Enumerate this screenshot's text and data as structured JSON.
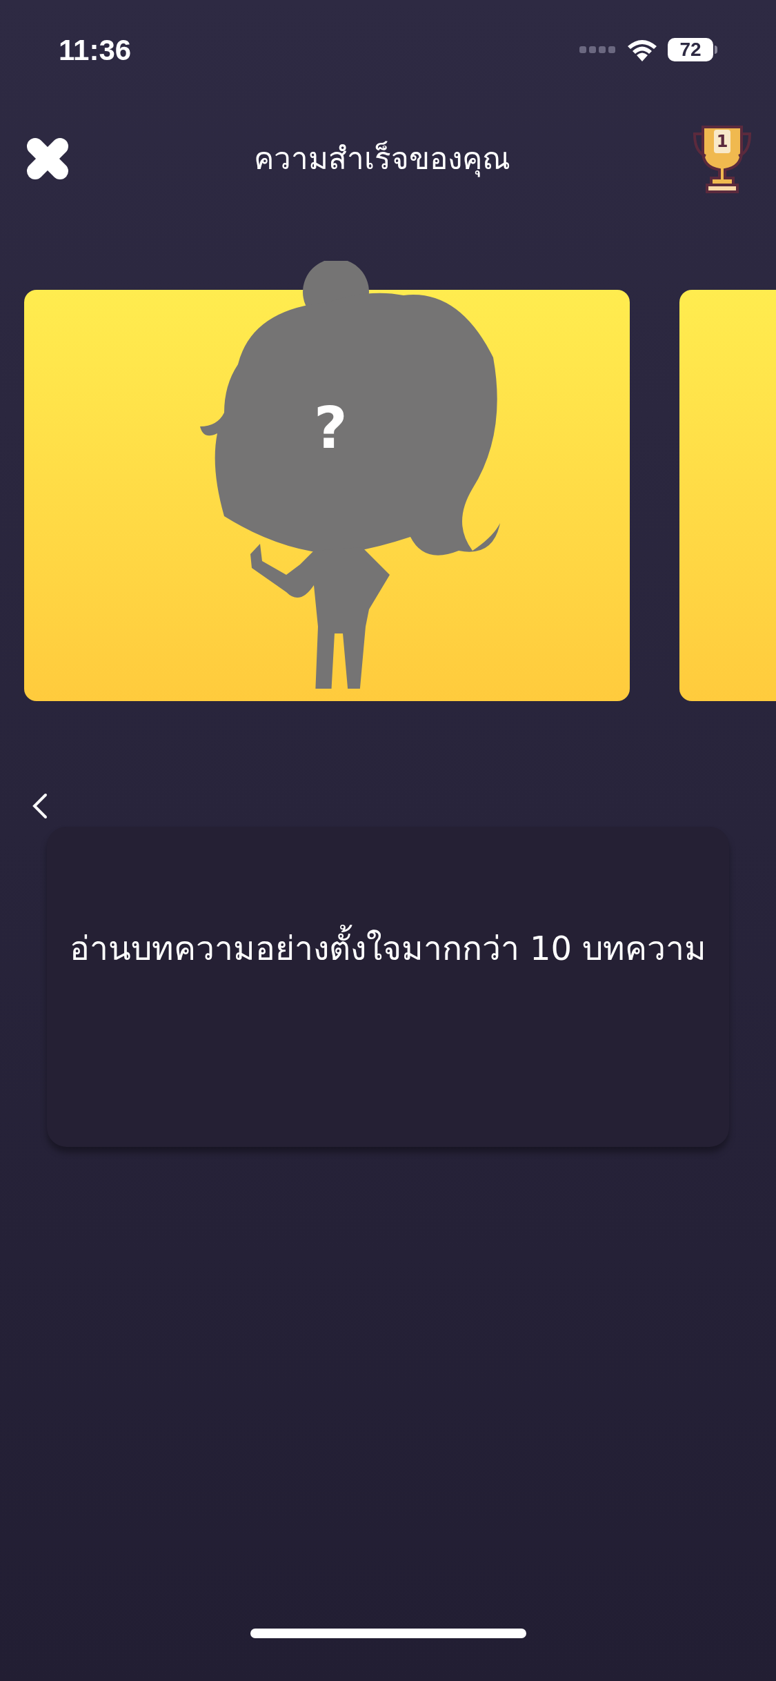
{
  "status_bar": {
    "time": "11:36",
    "battery": "72"
  },
  "header": {
    "title": "ความสำเร็จของคุณ",
    "trophy_rank": "1"
  },
  "cards": [
    {
      "mystery_mark": "?",
      "locked": true
    }
  ],
  "achievement": {
    "description": "อ่านบทความอย่างตั้งใจมากกว่า 10 บทความ"
  }
}
